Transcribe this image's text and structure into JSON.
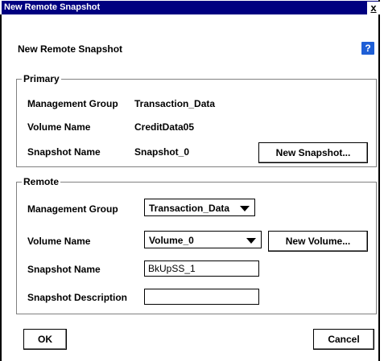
{
  "window": {
    "title": "New Remote Snapshot",
    "close_symbol": "x"
  },
  "header": {
    "subtitle": "New Remote Snapshot",
    "help_symbol": "?"
  },
  "primary": {
    "legend": "Primary",
    "management_group_label": "Management Group",
    "management_group_value": "Transaction_Data",
    "volume_name_label": "Volume Name",
    "volume_name_value": "CreditData05",
    "snapshot_name_label": "Snapshot Name",
    "snapshot_name_value": "Snapshot_0",
    "new_snapshot_button": "New Snapshot..."
  },
  "remote": {
    "legend": "Remote",
    "management_group_label": "Management Group",
    "management_group_selected": "Transaction_Data",
    "volume_name_label": "Volume Name",
    "volume_name_selected": "Volume_0",
    "new_volume_button": "New Volume...",
    "snapshot_name_label": "Snapshot Name",
    "snapshot_name_value": "BkUpSS_1",
    "snapshot_description_label": "Snapshot Description",
    "snapshot_description_value": ""
  },
  "footer": {
    "ok_button": "OK",
    "cancel_button": "Cancel"
  }
}
